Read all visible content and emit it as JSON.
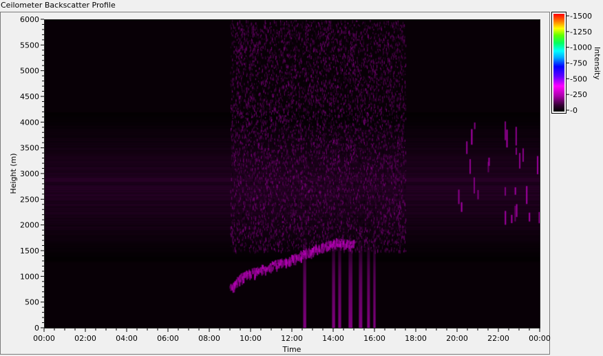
{
  "window": {
    "title": "Ceilometer Backscatter Profile"
  },
  "colorbar": {
    "label": "Intensity",
    "ticks": [
      "-1500",
      "-1250",
      "-1000",
      "-750",
      "-500",
      "-250",
      "-0"
    ],
    "colors": [
      "#000000",
      "#aa00aa",
      "#ff00ff",
      "#0000ff",
      "#00ffff",
      "#00ff00",
      "#ffff00",
      "#ff0000"
    ]
  },
  "chart_data": {
    "type": "heatmap",
    "title": "Ceilometer Backscatter Profile",
    "xlabel": "Time",
    "ylabel": "Height (m)",
    "x_ticks": [
      "00:00",
      "02:00",
      "04:00",
      "06:00",
      "08:00",
      "10:00",
      "12:00",
      "14:00",
      "16:00",
      "18:00",
      "20:00",
      "22:00",
      "00:00"
    ],
    "y_ticks": [
      "0",
      "500",
      "1000",
      "1500",
      "2000",
      "2500",
      "3000",
      "3500",
      "4000",
      "4500",
      "5000",
      "5500",
      "6000"
    ],
    "xlim_hours": [
      0,
      24
    ],
    "ylim": [
      0,
      6000
    ],
    "colorbar_range": [
      0,
      1500
    ],
    "grid": false,
    "colormap": "black-magenta-blue-cyan-green-yellow-red",
    "background_color": "#080006",
    "features": [
      {
        "kind": "residual layer",
        "time_start_h": 0,
        "time_end_h": 24,
        "height_start_m": 1300,
        "height_end_m": 4200,
        "intensity": 120
      },
      {
        "kind": "diffuse scattering",
        "time_start_h": 9,
        "time_end_h": 17.5,
        "height_start_m": 1500,
        "height_end_m": 6000,
        "intensity": 250
      },
      {
        "kind": "boundary layer top",
        "points": [
          [
            9.0,
            800
          ],
          [
            9.5,
            1000
          ],
          [
            10.0,
            1100
          ],
          [
            10.8,
            1200
          ],
          [
            11.5,
            1300
          ],
          [
            12.2,
            1400
          ],
          [
            12.8,
            1500
          ],
          [
            13.5,
            1600
          ],
          [
            14.2,
            1700
          ],
          [
            15.0,
            1650
          ]
        ],
        "intensity": 330
      },
      {
        "kind": "precipitation streaks",
        "times_h": [
          12.6,
          14.0,
          14.3,
          14.8,
          15.3,
          15.7,
          16.0
        ],
        "height_top_m": 1700,
        "intensity": 300
      },
      {
        "kind": "cloud streaks",
        "time_start_h": 20.0,
        "time_end_h": 24.0,
        "height_start_m": 2200,
        "height_end_m": 4100,
        "intensity": 350
      }
    ]
  }
}
